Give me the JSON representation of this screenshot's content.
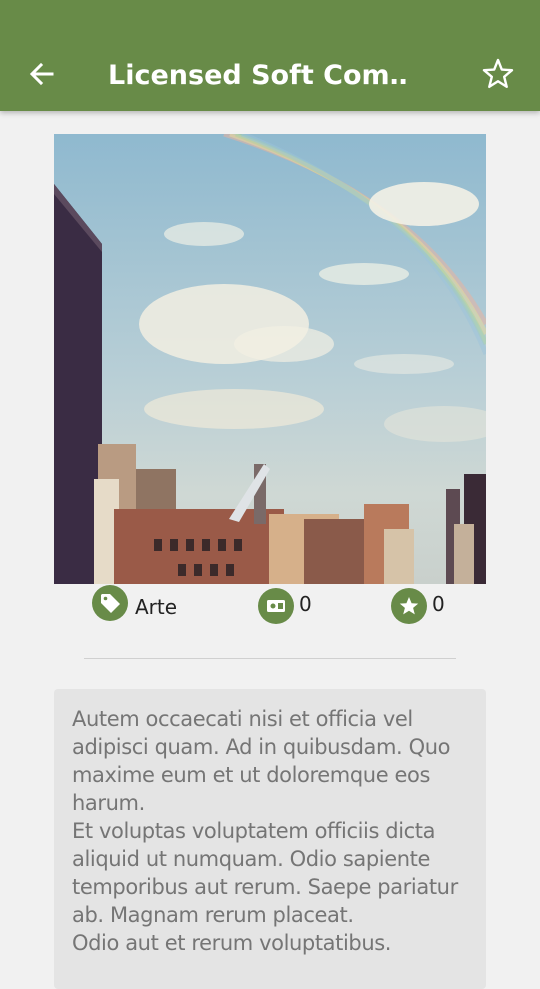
{
  "app_bar": {
    "title": "Licensed Soft Com…",
    "background": "#688b48",
    "back_icon": "arrow-left-icon",
    "favorite_icon": "star-outline-icon"
  },
  "image": {
    "subject": "city skyline with rainbow"
  },
  "meta": {
    "category_icon": "tag-icon",
    "category": "Arte",
    "views_icon": "viewer-icon",
    "views": "0",
    "rating_icon": "star-icon",
    "rating": "0"
  },
  "description": {
    "text": "Autem occaecati nisi et officia vel adipisci quam. Ad in quibusdam. Quo maxime eum et ut doloremque eos harum.\n  Et voluptas voluptatem officiis dicta aliquid ut numquam. Odio sapiente temporibus aut rerum. Saepe pariatur ab. Magnam rerum placeat.\n  Odio aut et rerum voluptatibus."
  }
}
